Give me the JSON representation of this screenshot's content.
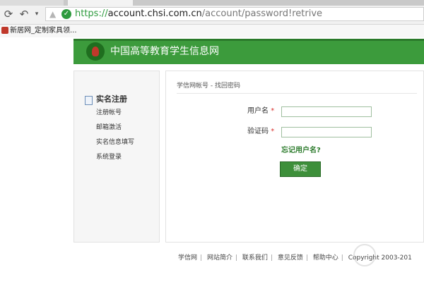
{
  "browser": {
    "url": {
      "scheme": "https://",
      "host": "account.chsi.com.cn",
      "path": "/account/password!retrive"
    },
    "bookmark": "新居网_定制家具领...",
    "icons": {
      "refresh": "refresh-icon",
      "back": "back-icon",
      "secure": "secure-check-icon"
    }
  },
  "site": {
    "title": "中国高等教育学生信息网"
  },
  "sidebar": {
    "heading": "实名注册",
    "items": [
      {
        "label": "注册帐号"
      },
      {
        "label": "邮箱激活"
      },
      {
        "label": "实名信息填写"
      },
      {
        "label": "系统登录"
      }
    ]
  },
  "form": {
    "breadcrumb": "学信网帐号 - 找回密码",
    "username_label": "用户名",
    "captcha_label": "验证码",
    "required_mark": "*",
    "username_value": "",
    "captcha_value": "",
    "forgot_link": "忘记用户名?",
    "submit_label": "确定"
  },
  "footer": {
    "links": [
      "学信网",
      "网站简介",
      "联系我们",
      "意见反馈",
      "帮助中心"
    ],
    "copyright": "Copyright 2003-201"
  },
  "colors": {
    "brand_green": "#3c9b3c",
    "link_green": "#2a7a2a",
    "required_red": "#d9302c"
  }
}
